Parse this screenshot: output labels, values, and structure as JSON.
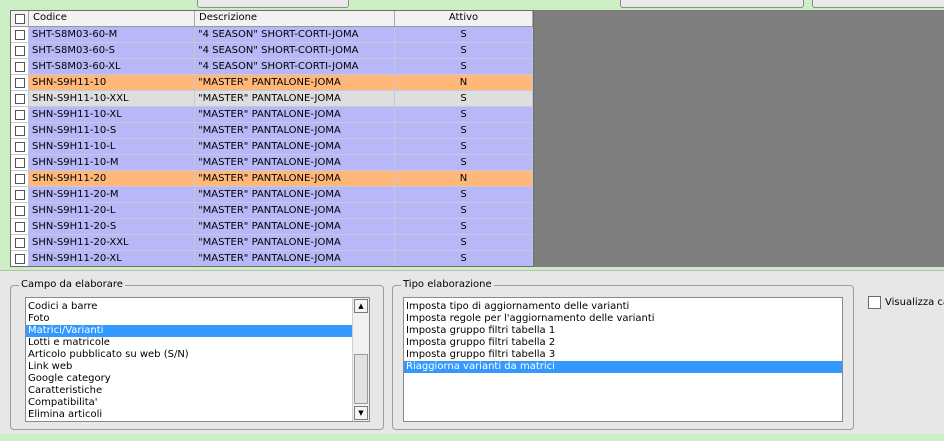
{
  "grid": {
    "columns": {
      "code": "Codice",
      "description": "Descrizione",
      "active": "Attivo"
    },
    "rows": [
      {
        "code": "SHT-S8M03-60-M",
        "description": "\"4 SEASON\"  SHORT-CORTI-JOMA",
        "active": "S",
        "style": "blue"
      },
      {
        "code": "SHT-S8M03-60-S",
        "description": "\"4 SEASON\"  SHORT-CORTI-JOMA",
        "active": "S",
        "style": "blue"
      },
      {
        "code": "SHT-S8M03-60-XL",
        "description": "\"4 SEASON\"  SHORT-CORTI-JOMA",
        "active": "S",
        "style": "blue"
      },
      {
        "code": "SHN-S9H11-10",
        "description": "\"MASTER\"  PANTALONE-JOMA",
        "active": "N",
        "style": "orange"
      },
      {
        "code": "SHN-S9H11-10-XXL",
        "description": "\"MASTER\"  PANTALONE-JOMA",
        "active": "S",
        "style": "gray"
      },
      {
        "code": "SHN-S9H11-10-XL",
        "description": "\"MASTER\"  PANTALONE-JOMA",
        "active": "S",
        "style": "blue"
      },
      {
        "code": "SHN-S9H11-10-S",
        "description": "\"MASTER\"  PANTALONE-JOMA",
        "active": "S",
        "style": "blue"
      },
      {
        "code": "SHN-S9H11-10-L",
        "description": "\"MASTER\"  PANTALONE-JOMA",
        "active": "S",
        "style": "blue"
      },
      {
        "code": "SHN-S9H11-10-M",
        "description": "\"MASTER\"  PANTALONE-JOMA",
        "active": "S",
        "style": "blue"
      },
      {
        "code": "SHN-S9H11-20",
        "description": "\"MASTER\"  PANTALONE-JOMA",
        "active": "N",
        "style": "orange"
      },
      {
        "code": "SHN-S9H11-20-M",
        "description": "\"MASTER\"  PANTALONE-JOMA",
        "active": "S",
        "style": "blue"
      },
      {
        "code": "SHN-S9H11-20-L",
        "description": "\"MASTER\"  PANTALONE-JOMA",
        "active": "S",
        "style": "blue"
      },
      {
        "code": "SHN-S9H11-20-S",
        "description": "\"MASTER\"  PANTALONE-JOMA",
        "active": "S",
        "style": "blue"
      },
      {
        "code": "SHN-S9H11-20-XXL",
        "description": "\"MASTER\"  PANTALONE-JOMA",
        "active": "S",
        "style": "blue"
      },
      {
        "code": "SHN-S9H11-20-XL",
        "description": "\"MASTER\"  PANTALONE-JOMA",
        "active": "S",
        "style": "blue"
      }
    ]
  },
  "campo": {
    "legend": "Campo da elaborare",
    "items": [
      "Codici a barre",
      "Foto",
      "Matrici/Varianti",
      "Lotti e matricole",
      "Articolo pubblicato su web (S/N)",
      "Link web",
      "Google category",
      "Caratteristiche",
      "Compatibilita'",
      "Elimina articoli"
    ],
    "selected": "Matrici/Varianti",
    "scroll_up_icon": "arrow-up-icon",
    "scroll_down_icon": "arrow-down-icon"
  },
  "tipo": {
    "legend": "Tipo elaborazione",
    "items": [
      "Imposta tipo di aggiornamento delle varianti",
      "Imposta regole per l'aggiornamento delle varianti",
      "Imposta gruppo filtri tabella 1",
      "Imposta gruppo filtri tabella 2",
      "Imposta gruppo filtri tabella 3",
      "Riaggiorna varianti da matrici"
    ],
    "selected": "Riaggiorna varianti da matrici"
  },
  "visualizza": {
    "label": "Visualizza cam",
    "checked": false
  },
  "colors": {
    "row_blue": "#b8b8f8",
    "row_orange": "#ffb87a",
    "row_gray": "#dedede",
    "selection": "#3399ff",
    "background": "#cdeec5"
  }
}
